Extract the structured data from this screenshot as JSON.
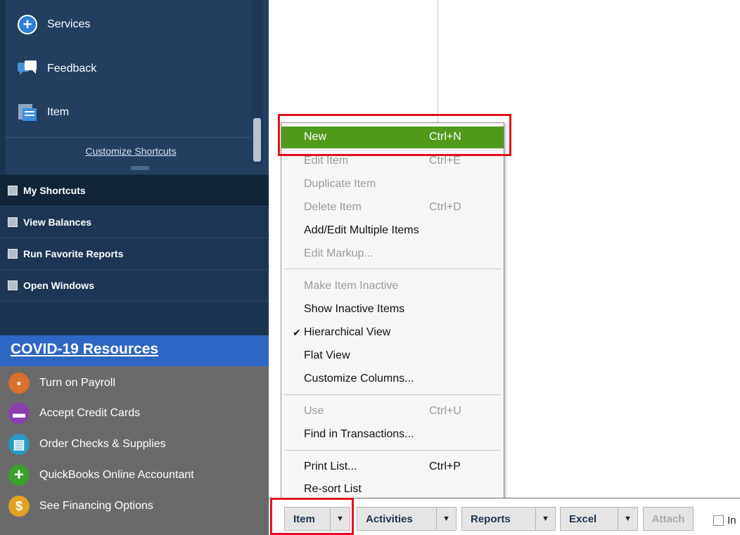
{
  "sidebar": {
    "shortcuts": [
      {
        "label": "Services",
        "icon": "plus-circle-icon"
      },
      {
        "label": "Feedback",
        "icon": "chat-bubbles-icon"
      },
      {
        "label": "Item",
        "icon": "item-list-icon"
      }
    ],
    "customize_label": "Customize Shortcuts",
    "nav": [
      {
        "label": "My Shortcuts",
        "icon": "arrow-box-icon"
      },
      {
        "label": "View Balances",
        "icon": "balance-icon"
      },
      {
        "label": "Run Favorite Reports",
        "icon": "bar-chart-icon"
      },
      {
        "label": "Open Windows",
        "icon": "window-icon"
      }
    ],
    "covid_label": "COVID-19 Resources",
    "promos": [
      {
        "label": "Turn on Payroll",
        "icon": "payroll-icon",
        "color": "#d9702b"
      },
      {
        "label": "Accept Credit Cards",
        "icon": "credit-card-icon",
        "color": "#8a3fb0"
      },
      {
        "label": "Order Checks & Supplies",
        "icon": "printer-icon",
        "color": "#2a9bc4"
      },
      {
        "label": "QuickBooks Online Accountant",
        "icon": "plus-circle-icon",
        "color": "#3aa12c"
      },
      {
        "label": "See Financing Options",
        "icon": "dollar-icon",
        "color": "#e3a123"
      }
    ]
  },
  "menu": {
    "items": [
      {
        "label": "New",
        "shortcut": "Ctrl+N",
        "enabled": true,
        "highlighted": true
      },
      {
        "label": "Edit Item",
        "shortcut": "Ctrl+E",
        "enabled": false
      },
      {
        "label": "Duplicate Item",
        "shortcut": "",
        "enabled": false
      },
      {
        "label": "Delete Item",
        "shortcut": "Ctrl+D",
        "enabled": false
      },
      {
        "label": "Add/Edit Multiple Items",
        "shortcut": "",
        "enabled": true
      },
      {
        "label": "Edit Markup...",
        "shortcut": "",
        "enabled": false
      },
      {
        "label": "Make Item Inactive",
        "shortcut": "",
        "enabled": false
      },
      {
        "label": "Show Inactive Items",
        "shortcut": "",
        "enabled": true
      },
      {
        "label": "Hierarchical View",
        "shortcut": "",
        "enabled": true,
        "checked": true
      },
      {
        "label": "Flat View",
        "shortcut": "",
        "enabled": true
      },
      {
        "label": "Customize Columns...",
        "shortcut": "",
        "enabled": true
      },
      {
        "label": "Use",
        "shortcut": "Ctrl+U",
        "enabled": false
      },
      {
        "label": "Find in Transactions...",
        "shortcut": "",
        "enabled": true
      },
      {
        "label": "Print List...",
        "shortcut": "Ctrl+P",
        "enabled": true
      },
      {
        "label": "Re-sort List",
        "shortcut": "",
        "enabled": true
      }
    ]
  },
  "toolbar": {
    "item_label": "Item",
    "activities_label": "Activities",
    "reports_label": "Reports",
    "excel_label": "Excel",
    "attach_label": "Attach",
    "include_inactive_label": "In",
    "dropdown_arrow": "▼"
  },
  "colors": {
    "sidebar_bg": "#1c3350",
    "menu_highlight": "#4e9a1b",
    "annotation_red": "#e1121e",
    "covid_bar": "#2c67c4"
  }
}
